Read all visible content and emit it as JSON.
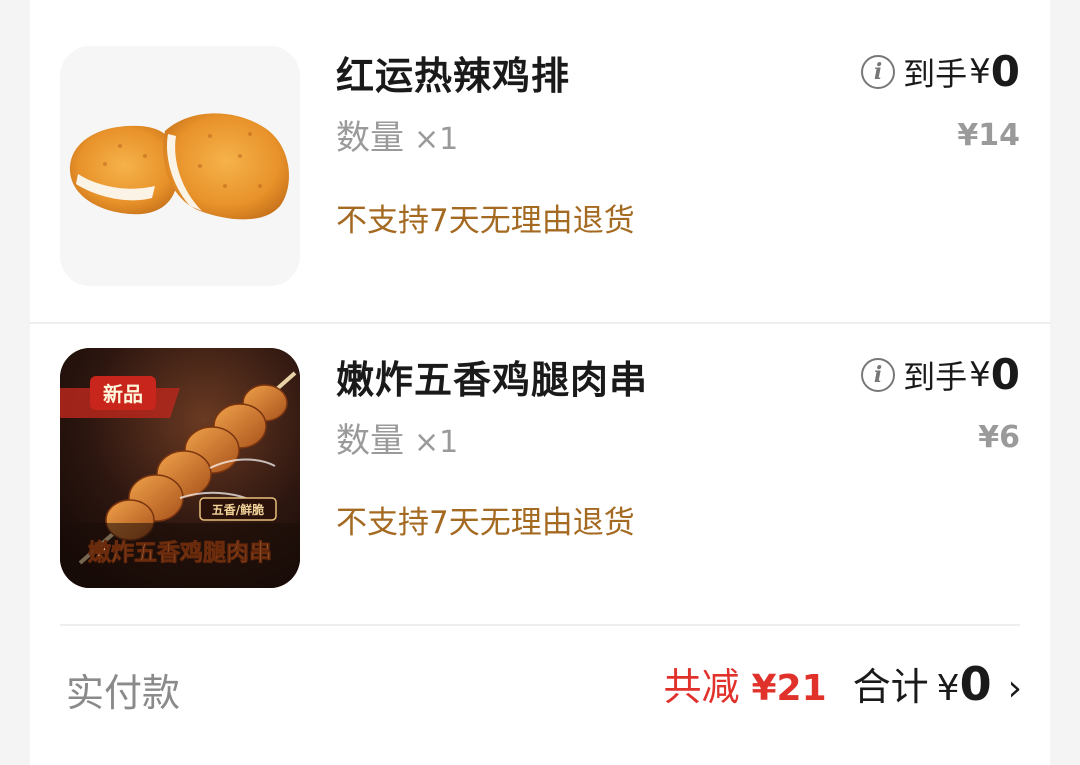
{
  "items": [
    {
      "title": "红运热辣鸡排",
      "qty_label": "数量",
      "qty_value": "×1",
      "policy": "不支持7天无理由退货",
      "final_label": "到手",
      "final_currency": "¥",
      "final_amount": "0",
      "original_price": "¥14",
      "image_icon": "fried-chicken-cutlet-image"
    },
    {
      "title": "嫩炸五香鸡腿肉串",
      "qty_label": "数量",
      "qty_value": "×1",
      "policy": "不支持7天无理由退货",
      "final_label": "到手",
      "final_currency": "¥",
      "final_amount": "0",
      "original_price": "¥6",
      "image_icon": "chicken-skewer-image",
      "image_badge": "新品",
      "image_tag": "五香/鲜脆",
      "image_caption": "嫩炸五香鸡腿肉串"
    }
  ],
  "footer": {
    "pay_label": "实付款",
    "discount_label": "共减",
    "discount_amount": "¥21",
    "total_label": "合计",
    "total_currency": "¥",
    "total_amount": "0",
    "chevron": "›"
  },
  "colors": {
    "discount_red": "#e0312b",
    "policy_brown": "#a46a22",
    "muted_gray": "#9a9a9a",
    "text_dark": "#1a1a1a"
  }
}
